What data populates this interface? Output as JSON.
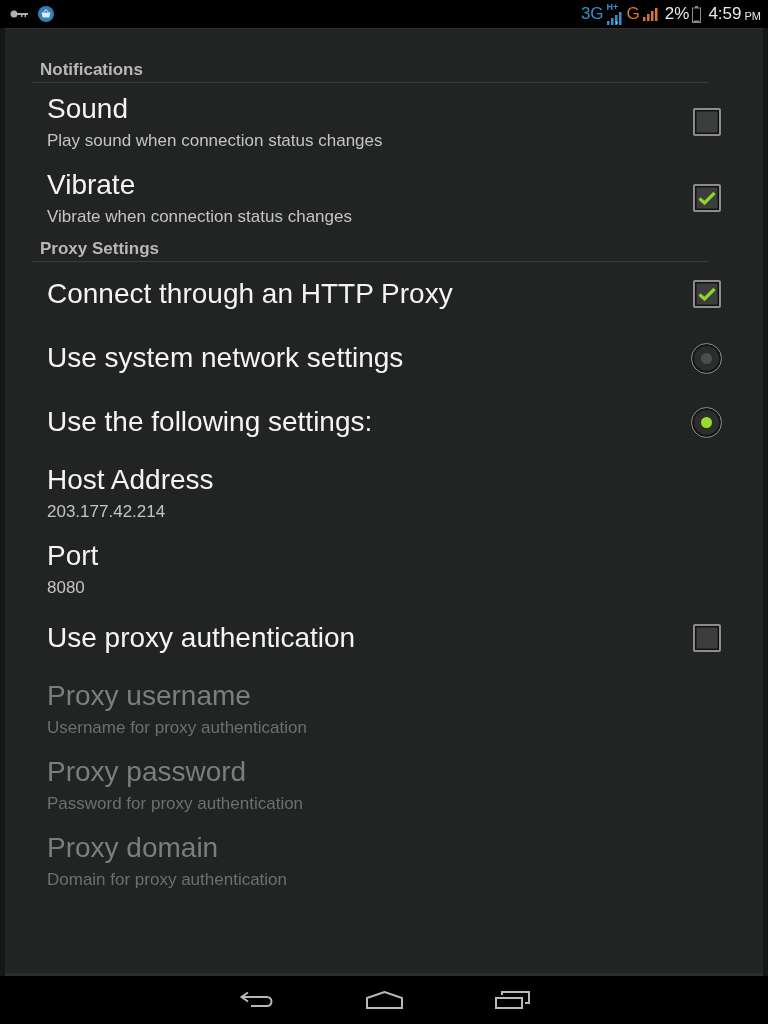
{
  "status_bar": {
    "network": "3G",
    "network_badge": "H+",
    "carrier_network": "G",
    "battery": "2%",
    "time": "4:59",
    "period": "PM"
  },
  "sections": [
    {
      "title": "Notifications",
      "items": [
        {
          "kind": "checkbox",
          "title": "Sound",
          "summary": "Play sound when connection status changes",
          "checked": false,
          "disabled": false
        },
        {
          "kind": "checkbox",
          "title": "Vibrate",
          "summary": "Vibrate when connection status changes",
          "checked": true,
          "disabled": false
        }
      ]
    },
    {
      "title": "Proxy Settings",
      "items": [
        {
          "kind": "checkbox",
          "title": "Connect through an HTTP Proxy",
          "checked": true,
          "disabled": false
        },
        {
          "kind": "radio",
          "title": "Use system network settings",
          "selected": false,
          "disabled": false
        },
        {
          "kind": "radio",
          "title": "Use the following settings:",
          "selected": true,
          "disabled": false
        },
        {
          "kind": "text",
          "title": "Host Address",
          "summary": "203.177.42.214",
          "disabled": false
        },
        {
          "kind": "text",
          "title": "Port",
          "summary": "8080",
          "disabled": false
        },
        {
          "kind": "checkbox",
          "title": "Use proxy authentication",
          "checked": false,
          "disabled": false
        },
        {
          "kind": "text",
          "title": "Proxy username",
          "summary": "Username for proxy authentication",
          "disabled": true
        },
        {
          "kind": "text",
          "title": "Proxy password",
          "summary": "Password for proxy authentication",
          "disabled": true
        },
        {
          "kind": "text",
          "title": "Proxy domain",
          "summary": "Domain for proxy authentication",
          "disabled": true
        }
      ]
    }
  ]
}
